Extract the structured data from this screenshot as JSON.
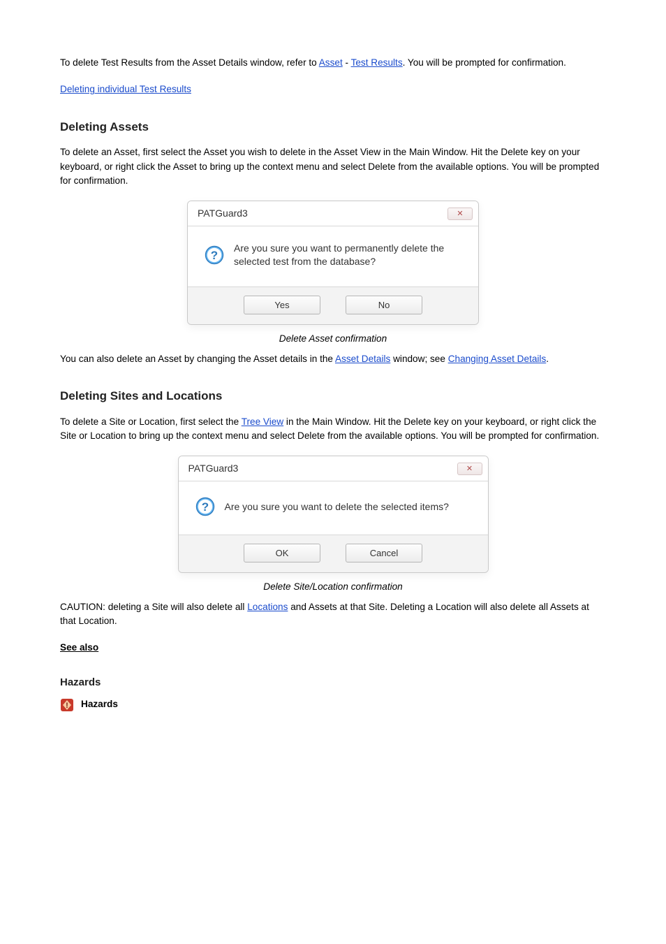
{
  "text": {
    "intro_prefix": "To delete Test Results from the Asset Details window, refer to ",
    "intro_link1": "Asset",
    "intro_between_links": " - ",
    "intro_link2": "Test Results",
    "intro_suffix": ". You will be prompted for confirmation.",
    "anchor_deleting_results": "Deleting individual Test Results",
    "heading_deleting_assets": "Deleting Assets",
    "deleting_assets_body": "To delete an Asset, first select the Asset you wish to delete in the Asset View in the Main Window. Hit the Delete key on your keyboard, or right click the Asset to bring up the context menu and select Delete from the available options. You will be prompted for confirmation.",
    "caption_delete_asset": "Delete Asset confirmation",
    "deleting_assets_followup_1": "You can also delete an Asset by changing the Asset details in the ",
    "deleting_assets_followup_link": "Asset Details",
    "deleting_assets_followup_2": " window; see ",
    "deleting_assets_followup_link2": "Changing Asset Details",
    "deleting_assets_followup_3": ".",
    "heading_deleting_sites": "Deleting Sites and Locations",
    "deleting_sites_body_1": "To delete a Site or Location, first select the ",
    "deleting_sites_body_link": "Tree View",
    "deleting_sites_body_2": " in the Main Window. Hit the Delete key on your keyboard, or right click the Site or Location to bring up the context menu and select Delete from the available options. You will be prompted for confirmation.",
    "caption_delete_site": "Delete Site/Location confirmation",
    "caution_prefix": "CAUTION: deleting a Site will also delete all ",
    "caution_link": "Locations",
    "caution_suffix": " and Assets at that Site. Deleting a Location will also delete all Assets at that Location.",
    "see_also": "See also",
    "heading_hazards": "Hazards",
    "hazard_icon_name": "Hazards"
  },
  "dialog1": {
    "title": "PATGuard3",
    "message": "Are you sure you want to permanently delete the selected test from the database?",
    "yes": "Yes",
    "no": "No"
  },
  "dialog2": {
    "title": "PATGuard3",
    "message": "Are you sure you want to delete the selected items?",
    "ok": "OK",
    "cancel": "Cancel"
  }
}
